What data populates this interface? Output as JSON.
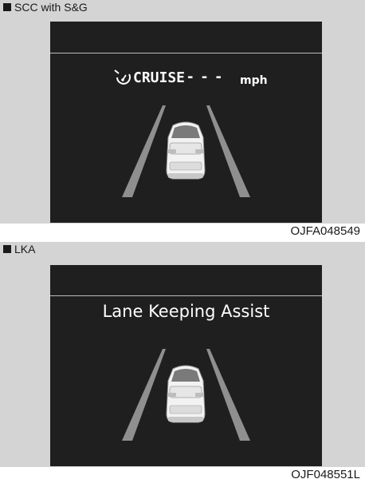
{
  "figures": [
    {
      "section_label": "SCC with S&G",
      "display": {
        "icon": "cruise-gauge-icon",
        "status_text": "CRUISE",
        "speed_value": "- - -",
        "speed_unit": "mph"
      },
      "reference_code": "OJFA048549"
    },
    {
      "section_label": "LKA",
      "display": {
        "title": "Lane Keeping Assist"
      },
      "reference_code": "OJF048551L"
    }
  ],
  "colors": {
    "panel_background": "#d4d4d4",
    "screen_background": "#1f1f1f",
    "display_text": "#ffffff",
    "lane_marking": "#8f8f8f"
  }
}
